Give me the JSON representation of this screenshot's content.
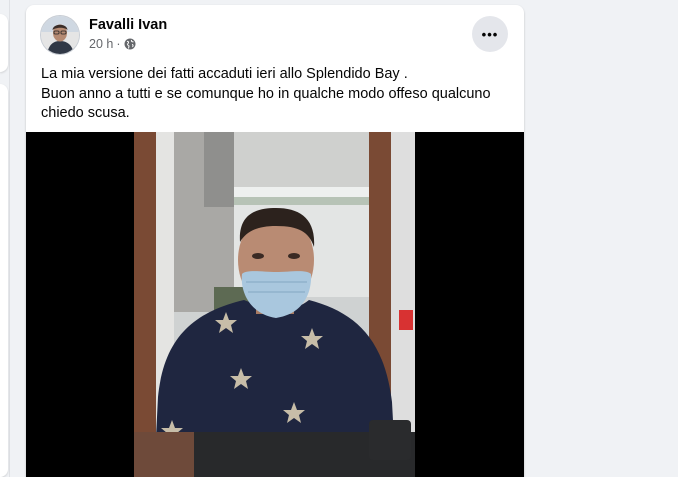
{
  "post": {
    "author": "Favalli Ivan",
    "time": "20 h",
    "separator": "·",
    "privacy_icon": "globe-icon",
    "more_icon": "more-options-icon",
    "more_label": "•••",
    "text_lines": [
      "La mia versione dei fatti accaduti ieri allo Splendido Bay .",
      "Buon anno a tutti e se comunque ho in qualche modo offeso qualcuno",
      "chiedo scusa."
    ]
  },
  "colors": {
    "background": "#f0f2f5",
    "card": "#ffffff",
    "name": "#050505",
    "meta": "#65676b",
    "more_button_bg": "#e4e6eb"
  }
}
